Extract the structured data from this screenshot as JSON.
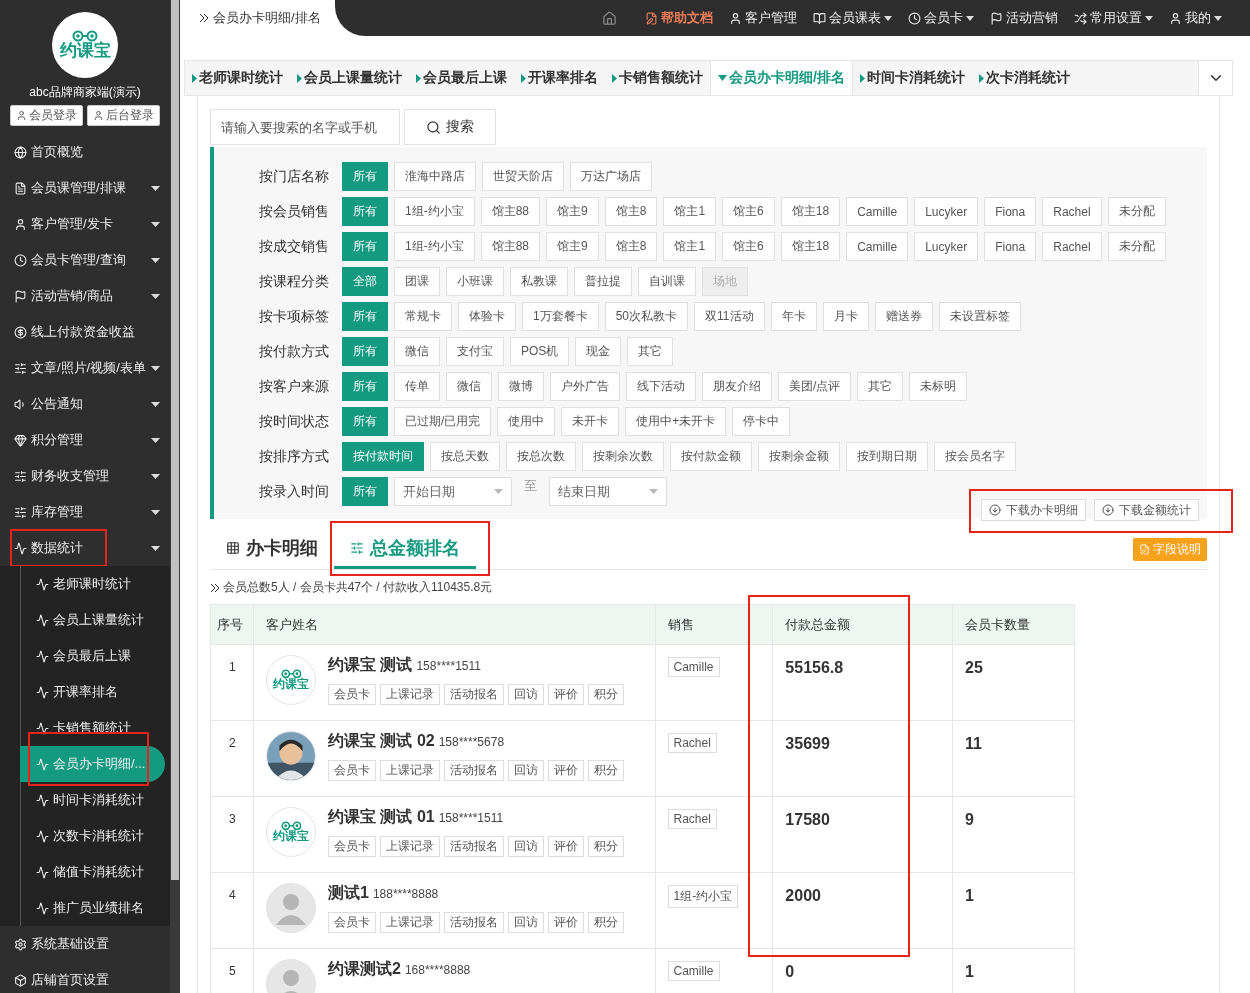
{
  "sidebar": {
    "logo_text": "约课宝",
    "brand": "abc品牌商家端(演示)",
    "login_buttons": [
      "会员登录",
      "后台登录"
    ],
    "items": [
      {
        "label": "首页概览",
        "has_submenu": false
      },
      {
        "label": "会员课管理/排课",
        "has_submenu": true
      },
      {
        "label": "客户管理/发卡",
        "has_submenu": true
      },
      {
        "label": "会员卡管理/查询",
        "has_submenu": true
      },
      {
        "label": "活动营销/商品",
        "has_submenu": true
      },
      {
        "label": "线上付款资金收益",
        "has_submenu": false
      },
      {
        "label": "文章/照片/视频/表单",
        "has_submenu": true
      },
      {
        "label": "公告通知",
        "has_submenu": true
      },
      {
        "label": "积分管理",
        "has_submenu": true
      },
      {
        "label": "财务收支管理",
        "has_submenu": true
      },
      {
        "label": "库存管理",
        "has_submenu": true
      },
      {
        "label": "数据统计",
        "has_submenu": true,
        "expanded": true,
        "highlighted": true,
        "children": [
          {
            "label": "老师课时统计",
            "selected": false
          },
          {
            "label": "会员上课量统计",
            "selected": false
          },
          {
            "label": "会员最后上课",
            "selected": false
          },
          {
            "label": "开课率排名",
            "selected": false
          },
          {
            "label": "卡销售额统计",
            "selected": false
          },
          {
            "label": "会员办卡明细/...",
            "selected": true,
            "highlighted": true
          },
          {
            "label": "时间卡消耗统计",
            "selected": false
          },
          {
            "label": "次数卡消耗统计",
            "selected": false
          },
          {
            "label": "储值卡消耗统计",
            "selected": false
          },
          {
            "label": "推广员业绩排名",
            "selected": false
          }
        ]
      },
      {
        "label": "系统基础设置",
        "has_submenu": false
      },
      {
        "label": "店铺首页设置",
        "has_submenu": false
      }
    ]
  },
  "topbar": {
    "breadcrumb": "会员办卡明细/排名",
    "nav": [
      {
        "kind": "home"
      },
      {
        "kind": "help",
        "label": "帮助文档",
        "has_dropdown": false
      },
      {
        "kind": "user",
        "label": "客户管理",
        "has_dropdown": false
      },
      {
        "kind": "book",
        "label": "会员课表",
        "has_dropdown": true
      },
      {
        "kind": "clock",
        "label": "会员卡",
        "has_dropdown": true
      },
      {
        "kind": "flag",
        "label": "活动营销",
        "has_dropdown": false
      },
      {
        "kind": "settings",
        "label": "常用设置",
        "has_dropdown": true
      },
      {
        "kind": "me",
        "label": "我的",
        "has_dropdown": true
      }
    ]
  },
  "stat_tabs": [
    {
      "label": "老师课时统计",
      "selected": false
    },
    {
      "label": "会员上课量统计",
      "selected": false
    },
    {
      "label": "会员最后上课",
      "selected": false
    },
    {
      "label": "开课率排名",
      "selected": false
    },
    {
      "label": "卡销售额统计",
      "selected": false
    },
    {
      "label": "会员办卡明细/排名",
      "selected": true
    },
    {
      "label": "时间卡消耗统计",
      "selected": false
    },
    {
      "label": "次卡消耗统计",
      "selected": false
    }
  ],
  "search": {
    "placeholder": "请输入要搜索的名字或手机",
    "button": "搜索"
  },
  "filters": [
    {
      "label": "按门店名称",
      "options": [
        {
          "label": "所有",
          "selected": true
        },
        {
          "label": "淮海中路店",
          "selected": false
        },
        {
          "label": "世贸天阶店",
          "selected": false
        },
        {
          "label": "万达广场店",
          "selected": false
        }
      ]
    },
    {
      "label": "按会员销售",
      "options": [
        {
          "label": "所有",
          "selected": true
        },
        {
          "label": "1组-约小宝",
          "selected": false
        },
        {
          "label": "馆主88",
          "selected": false
        },
        {
          "label": "馆主9",
          "selected": false
        },
        {
          "label": "馆主8",
          "selected": false
        },
        {
          "label": "馆主1",
          "selected": false
        },
        {
          "label": "馆主6",
          "selected": false
        },
        {
          "label": "馆主18",
          "selected": false
        },
        {
          "label": "Camille",
          "selected": false
        },
        {
          "label": "Lucyker",
          "selected": false
        },
        {
          "label": "Fiona",
          "selected": false
        },
        {
          "label": "Rachel",
          "selected": false
        },
        {
          "label": "未分配",
          "selected": false
        }
      ]
    },
    {
      "label": "按成交销售",
      "options": [
        {
          "label": "所有",
          "selected": true
        },
        {
          "label": "1组-约小宝",
          "selected": false
        },
        {
          "label": "馆主88",
          "selected": false
        },
        {
          "label": "馆主9",
          "selected": false
        },
        {
          "label": "馆主8",
          "selected": false
        },
        {
          "label": "馆主1",
          "selected": false
        },
        {
          "label": "馆主6",
          "selected": false
        },
        {
          "label": "馆主18",
          "selected": false
        },
        {
          "label": "Camille",
          "selected": false
        },
        {
          "label": "Lucyker",
          "selected": false
        },
        {
          "label": "Fiona",
          "selected": false
        },
        {
          "label": "Rachel",
          "selected": false
        },
        {
          "label": "未分配",
          "selected": false
        }
      ]
    },
    {
      "label": "按课程分类",
      "options": [
        {
          "label": "全部",
          "selected": true
        },
        {
          "label": "团课",
          "selected": false
        },
        {
          "label": "小班课",
          "selected": false
        },
        {
          "label": "私教课",
          "selected": false
        },
        {
          "label": "普拉提",
          "selected": false
        },
        {
          "label": "自训课",
          "selected": false
        },
        {
          "label": "场地",
          "selected": false,
          "disabled": true
        }
      ]
    },
    {
      "label": "按卡项标签",
      "options": [
        {
          "label": "所有",
          "selected": true
        },
        {
          "label": "常规卡",
          "selected": false
        },
        {
          "label": "体验卡",
          "selected": false
        },
        {
          "label": "1万套餐卡",
          "selected": false
        },
        {
          "label": "50次私教卡",
          "selected": false
        },
        {
          "label": "双11活动",
          "selected": false
        },
        {
          "label": "年卡",
          "selected": false
        },
        {
          "label": "月卡",
          "selected": false
        },
        {
          "label": "赠送券",
          "selected": false
        },
        {
          "label": "未设置标签",
          "selected": false
        }
      ]
    },
    {
      "label": "按付款方式",
      "options": [
        {
          "label": "所有",
          "selected": true
        },
        {
          "label": "微信",
          "selected": false
        },
        {
          "label": "支付宝",
          "selected": false
        },
        {
          "label": "POS机",
          "selected": false
        },
        {
          "label": "现金",
          "selected": false
        },
        {
          "label": "其它",
          "selected": false
        }
      ]
    },
    {
      "label": "按客户来源",
      "options": [
        {
          "label": "所有",
          "selected": true
        },
        {
          "label": "传单",
          "selected": false
        },
        {
          "label": "微信",
          "selected": false
        },
        {
          "label": "微博",
          "selected": false
        },
        {
          "label": "户外广告",
          "selected": false
        },
        {
          "label": "线下活动",
          "selected": false
        },
        {
          "label": "朋友介绍",
          "selected": false
        },
        {
          "label": "美团/点评",
          "selected": false
        },
        {
          "label": "其它",
          "selected": false
        },
        {
          "label": "未标明",
          "selected": false
        }
      ]
    },
    {
      "label": "按时间状态",
      "options": [
        {
          "label": "所有",
          "selected": true
        },
        {
          "label": "已过期/已用完",
          "selected": false
        },
        {
          "label": "使用中",
          "selected": false
        },
        {
          "label": "未开卡",
          "selected": false
        },
        {
          "label": "使用中+未开卡",
          "selected": false
        },
        {
          "label": "停卡中",
          "selected": false
        }
      ]
    },
    {
      "label": "按排序方式",
      "options": [
        {
          "label": "按付款时间",
          "selected": true
        },
        {
          "label": "按总天数",
          "selected": false
        },
        {
          "label": "按总次数",
          "selected": false
        },
        {
          "label": "按剩余次数",
          "selected": false
        },
        {
          "label": "按付款金额",
          "selected": false
        },
        {
          "label": "按剩余金额",
          "selected": false
        },
        {
          "label": "按到期日期",
          "selected": false
        },
        {
          "label": "按会员名字",
          "selected": false
        }
      ]
    }
  ],
  "date_filter": {
    "label": "按录入时间",
    "option": {
      "label": "所有",
      "selected": true
    },
    "start_placeholder": "开始日期",
    "separator": "至",
    "end_placeholder": "结束日期"
  },
  "downloads": {
    "highlighted": true,
    "buttons": [
      "下载办卡明细",
      "下载金额统计"
    ]
  },
  "view_tabs": [
    {
      "kind": "calendar",
      "label": "办卡明细",
      "selected": false
    },
    {
      "kind": "sliders",
      "label": "总金额排名",
      "selected": true,
      "highlighted": true
    }
  ],
  "field_help": "字段说明",
  "summary": "会员总数5人 / 会员卡共47个 / 付款收入110435.8元",
  "table": {
    "columns": [
      {
        "label": "序号"
      },
      {
        "label": "客户姓名"
      },
      {
        "label": "销售"
      },
      {
        "label": "付款总金额",
        "highlighted": true
      },
      {
        "label": "会员卡数量"
      }
    ],
    "rows": [
      {
        "index": "1",
        "avatar": {
          "kind": "logo",
          "text": "约课宝"
        },
        "name": "约课宝 测试",
        "phone": "158****1511",
        "sales": "Camille",
        "amount": "55156.8",
        "cards": "25",
        "actions": [
          "会员卡",
          "上课记录",
          "活动报名",
          "回访",
          "评价",
          "积分"
        ]
      },
      {
        "index": "2",
        "avatar": {
          "kind": "picture"
        },
        "name": "约课宝 测试 02",
        "phone": "158****5678",
        "sales": "Rachel",
        "amount": "35699",
        "cards": "11",
        "actions": [
          "会员卡",
          "上课记录",
          "活动报名",
          "回访",
          "评价",
          "积分"
        ]
      },
      {
        "index": "3",
        "avatar": {
          "kind": "logo",
          "text": "约课宝"
        },
        "name": "约课宝 测试 01",
        "phone": "158****1511",
        "sales": "Rachel",
        "amount": "17580",
        "cards": "9",
        "actions": [
          "会员卡",
          "上课记录",
          "活动报名",
          "回访",
          "评价",
          "积分"
        ]
      },
      {
        "index": "4",
        "avatar": {
          "kind": "default"
        },
        "name": "测试1",
        "phone": "188****8888",
        "sales": "1组-约小宝",
        "amount": "2000",
        "cards": "1",
        "actions": [
          "会员卡",
          "上课记录",
          "活动报名",
          "回访",
          "评价",
          "积分"
        ]
      },
      {
        "index": "5",
        "avatar": {
          "kind": "default"
        },
        "name": "约课测试2",
        "phone": "168****8888",
        "sales": "Camille",
        "amount": "0",
        "cards": "1"
      }
    ]
  }
}
